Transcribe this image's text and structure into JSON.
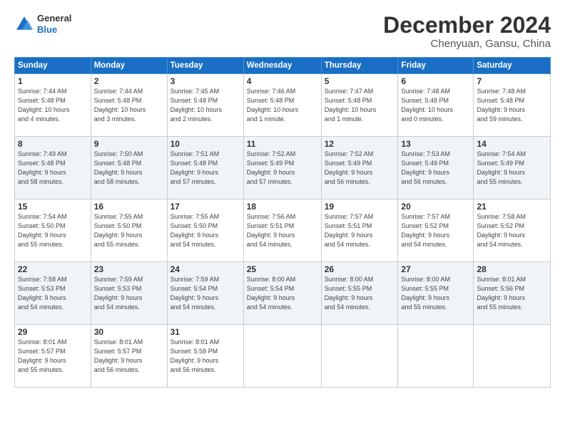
{
  "header": {
    "logo": {
      "line1": "General",
      "line2": "Blue"
    },
    "title": "December 2024",
    "location": "Chenyuan, Gansu, China"
  },
  "days_of_week": [
    "Sunday",
    "Monday",
    "Tuesday",
    "Wednesday",
    "Thursday",
    "Friday",
    "Saturday"
  ],
  "weeks": [
    [
      {
        "day": "1",
        "info": "Sunrise: 7:44 AM\nSunset: 5:48 PM\nDaylight: 10 hours\nand 4 minutes."
      },
      {
        "day": "2",
        "info": "Sunrise: 7:44 AM\nSunset: 5:48 PM\nDaylight: 10 hours\nand 3 minutes."
      },
      {
        "day": "3",
        "info": "Sunrise: 7:45 AM\nSunset: 5:48 PM\nDaylight: 10 hours\nand 2 minutes."
      },
      {
        "day": "4",
        "info": "Sunrise: 7:46 AM\nSunset: 5:48 PM\nDaylight: 10 hours\nand 1 minute."
      },
      {
        "day": "5",
        "info": "Sunrise: 7:47 AM\nSunset: 5:48 PM\nDaylight: 10 hours\nand 1 minute."
      },
      {
        "day": "6",
        "info": "Sunrise: 7:48 AM\nSunset: 5:48 PM\nDaylight: 10 hours\nand 0 minutes."
      },
      {
        "day": "7",
        "info": "Sunrise: 7:48 AM\nSunset: 5:48 PM\nDaylight: 9 hours\nand 59 minutes."
      }
    ],
    [
      {
        "day": "8",
        "info": "Sunrise: 7:49 AM\nSunset: 5:48 PM\nDaylight: 9 hours\nand 58 minutes."
      },
      {
        "day": "9",
        "info": "Sunrise: 7:50 AM\nSunset: 5:48 PM\nDaylight: 9 hours\nand 58 minutes."
      },
      {
        "day": "10",
        "info": "Sunrise: 7:51 AM\nSunset: 5:48 PM\nDaylight: 9 hours\nand 57 minutes."
      },
      {
        "day": "11",
        "info": "Sunrise: 7:52 AM\nSunset: 5:49 PM\nDaylight: 9 hours\nand 57 minutes."
      },
      {
        "day": "12",
        "info": "Sunrise: 7:52 AM\nSunset: 5:49 PM\nDaylight: 9 hours\nand 56 minutes."
      },
      {
        "day": "13",
        "info": "Sunrise: 7:53 AM\nSunset: 5:49 PM\nDaylight: 9 hours\nand 56 minutes."
      },
      {
        "day": "14",
        "info": "Sunrise: 7:54 AM\nSunset: 5:49 PM\nDaylight: 9 hours\nand 55 minutes."
      }
    ],
    [
      {
        "day": "15",
        "info": "Sunrise: 7:54 AM\nSunset: 5:50 PM\nDaylight: 9 hours\nand 55 minutes."
      },
      {
        "day": "16",
        "info": "Sunrise: 7:55 AM\nSunset: 5:50 PM\nDaylight: 9 hours\nand 55 minutes."
      },
      {
        "day": "17",
        "info": "Sunrise: 7:55 AM\nSunset: 5:50 PM\nDaylight: 9 hours\nand 54 minutes."
      },
      {
        "day": "18",
        "info": "Sunrise: 7:56 AM\nSunset: 5:51 PM\nDaylight: 9 hours\nand 54 minutes."
      },
      {
        "day": "19",
        "info": "Sunrise: 7:57 AM\nSunset: 5:51 PM\nDaylight: 9 hours\nand 54 minutes."
      },
      {
        "day": "20",
        "info": "Sunrise: 7:57 AM\nSunset: 5:52 PM\nDaylight: 9 hours\nand 54 minutes."
      },
      {
        "day": "21",
        "info": "Sunrise: 7:58 AM\nSunset: 5:52 PM\nDaylight: 9 hours\nand 54 minutes."
      }
    ],
    [
      {
        "day": "22",
        "info": "Sunrise: 7:58 AM\nSunset: 5:53 PM\nDaylight: 9 hours\nand 54 minutes."
      },
      {
        "day": "23",
        "info": "Sunrise: 7:59 AM\nSunset: 5:53 PM\nDaylight: 9 hours\nand 54 minutes."
      },
      {
        "day": "24",
        "info": "Sunrise: 7:59 AM\nSunset: 5:54 PM\nDaylight: 9 hours\nand 54 minutes."
      },
      {
        "day": "25",
        "info": "Sunrise: 8:00 AM\nSunset: 5:54 PM\nDaylight: 9 hours\nand 54 minutes."
      },
      {
        "day": "26",
        "info": "Sunrise: 8:00 AM\nSunset: 5:55 PM\nDaylight: 9 hours\nand 54 minutes."
      },
      {
        "day": "27",
        "info": "Sunrise: 8:00 AM\nSunset: 5:55 PM\nDaylight: 9 hours\nand 55 minutes."
      },
      {
        "day": "28",
        "info": "Sunrise: 8:01 AM\nSunset: 5:56 PM\nDaylight: 9 hours\nand 55 minutes."
      }
    ],
    [
      {
        "day": "29",
        "info": "Sunrise: 8:01 AM\nSunset: 5:57 PM\nDaylight: 9 hours\nand 55 minutes."
      },
      {
        "day": "30",
        "info": "Sunrise: 8:01 AM\nSunset: 5:57 PM\nDaylight: 9 hours\nand 56 minutes."
      },
      {
        "day": "31",
        "info": "Sunrise: 8:01 AM\nSunset: 5:58 PM\nDaylight: 9 hours\nand 56 minutes."
      },
      {
        "day": "",
        "info": ""
      },
      {
        "day": "",
        "info": ""
      },
      {
        "day": "",
        "info": ""
      },
      {
        "day": "",
        "info": ""
      }
    ]
  ]
}
